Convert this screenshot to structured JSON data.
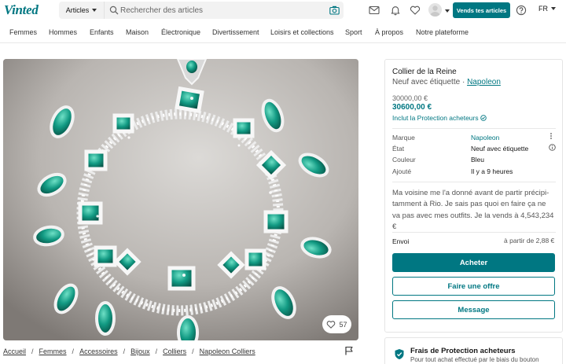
{
  "header": {
    "logo": "Vinted",
    "category_select": "Articles",
    "search_placeholder": "Rechercher des articles",
    "sell_button": "Vends tes articles",
    "language": "FR"
  },
  "nav": {
    "items": [
      "Femmes",
      "Hommes",
      "Enfants",
      "Maison",
      "Électronique",
      "Divertissement",
      "Loisirs et collections",
      "Sport",
      "À propos",
      "Notre plateforme"
    ]
  },
  "photo": {
    "like_count": "57"
  },
  "breadcrumb": [
    "Accueil",
    "Femmes",
    "Accessoires",
    "Bijoux",
    "Colliers",
    "Napoleon Colliers"
  ],
  "item": {
    "title": "Collier de la Reine",
    "condition": "Neuf avec étiquette",
    "separator": " · ",
    "brand_link": "Napoleon",
    "price_original": "30000,00 €",
    "price_total": "30600,00 €",
    "protection_note": "Inclut la Protection acheteurs",
    "details": [
      {
        "label": "Marque",
        "value": "Napoleon"
      },
      {
        "label": "État",
        "value": "Neuf avec étiquette"
      },
      {
        "label": "Couleur",
        "value": "Bleu"
      },
      {
        "label": "Ajouté",
        "value": "Il y a 9 heures"
      }
    ],
    "description": "Ma voisine me l'a donné avant de partir précipi-tamment à Rio. Je sais pas quoi en faire ça ne va pas avec mes outfits. Je la vends à 4,543,234 €",
    "shipping_label": "Envoi",
    "shipping_value": "à partir de 2,88 €",
    "buttons": {
      "buy": "Acheter",
      "offer": "Faire une offre",
      "message": "Message"
    }
  },
  "protection_box": {
    "title": "Frais de Protection acheteurs",
    "text": "Pour tout achat effectué par le biais du bouton"
  },
  "colors": {
    "brand": "#007782",
    "text": "#171717",
    "muted": "#555555"
  }
}
